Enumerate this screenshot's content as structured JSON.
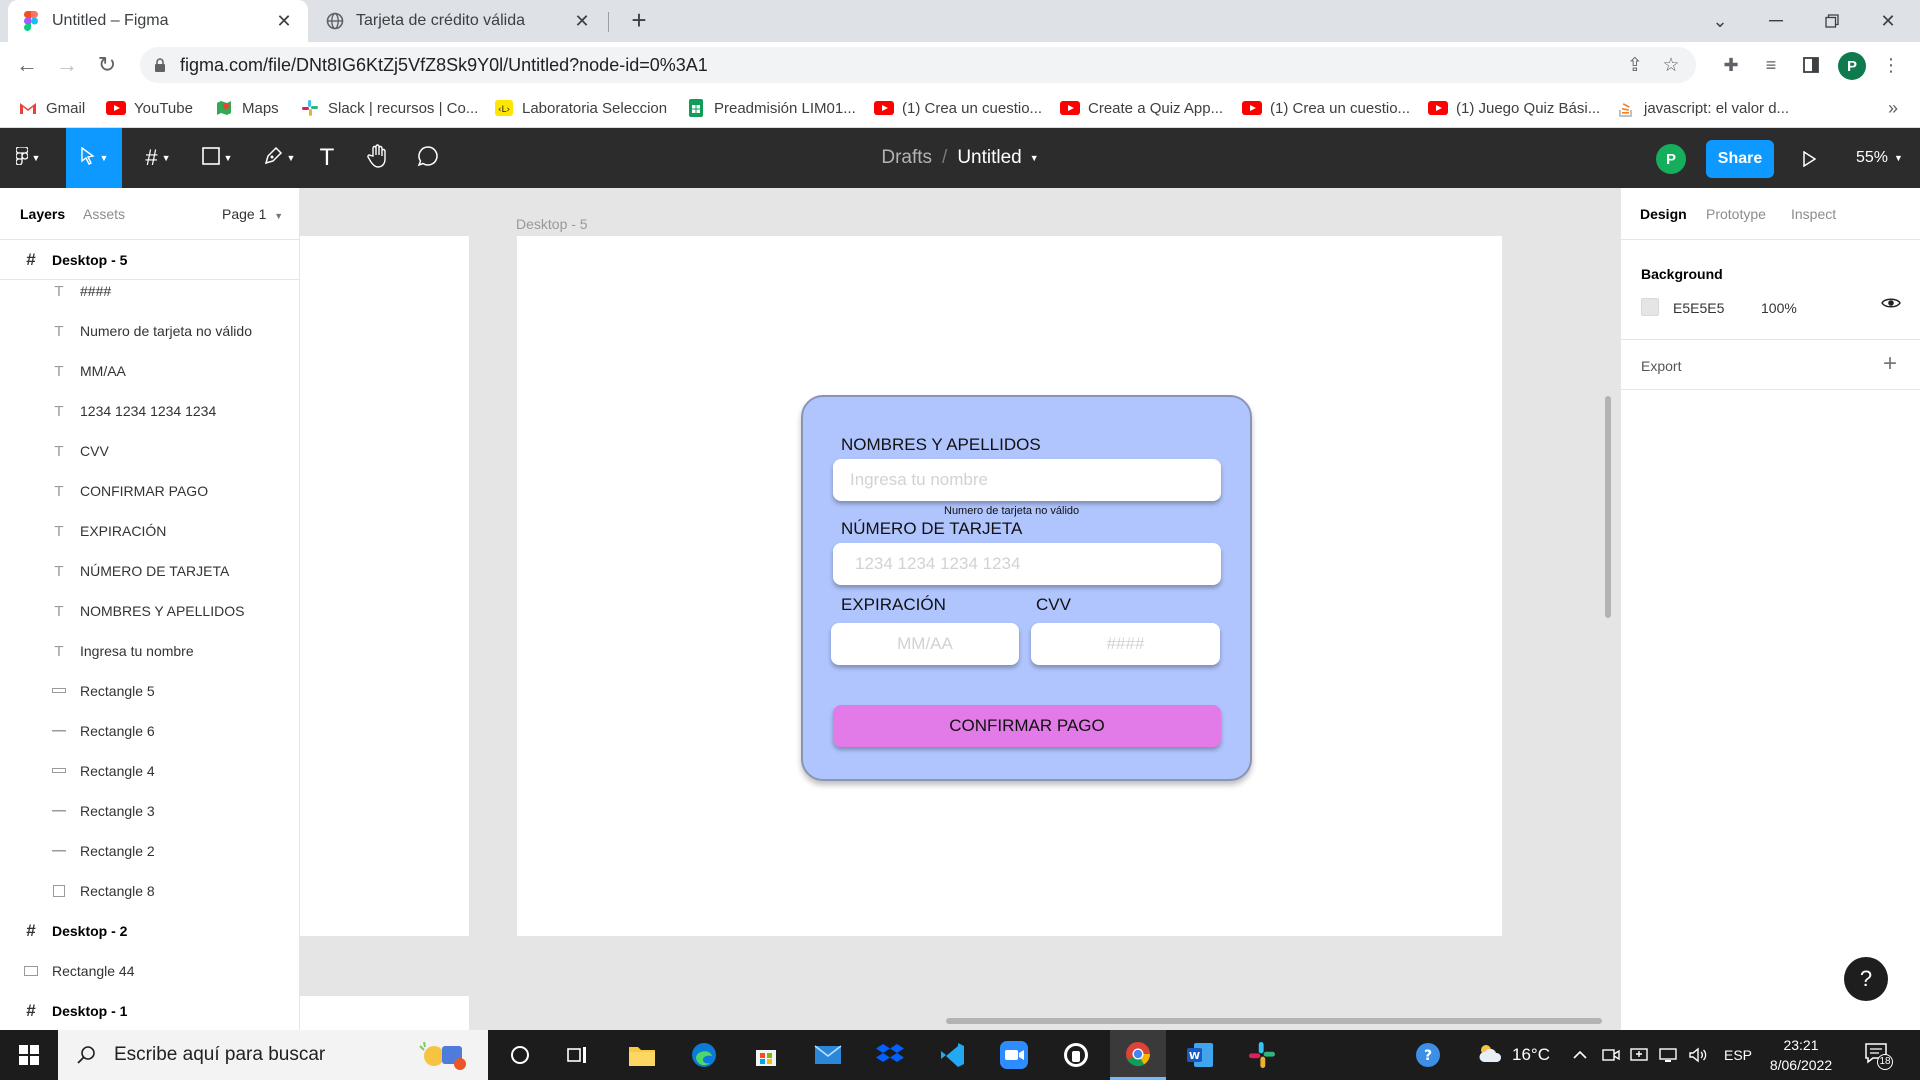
{
  "browser": {
    "tabs": [
      {
        "title": "Untitled – Figma",
        "active": true
      },
      {
        "title": "Tarjeta de crédito válida",
        "active": false
      }
    ],
    "url": "figma.com/file/DNt8IG6KtZj5VfZ8Sk9Y0l/Untitled?node-id=0%3A1",
    "profile_initial": "P",
    "bookmarks": [
      {
        "label": "Gmail",
        "icon": "gmail-icon"
      },
      {
        "label": "YouTube",
        "icon": "youtube-icon"
      },
      {
        "label": "Maps",
        "icon": "maps-icon"
      },
      {
        "label": "Slack | recursos | Co...",
        "icon": "slack-icon"
      },
      {
        "label": "Laboratoria Seleccion",
        "icon": "laboratoria-icon"
      },
      {
        "label": "Preadmisión LIM01...",
        "icon": "sheets-icon"
      },
      {
        "label": "(1) Crea un cuestio...",
        "icon": "youtube-icon"
      },
      {
        "label": "Create a Quiz App...",
        "icon": "youtube-icon"
      },
      {
        "label": "(1) Crea un cuestio...",
        "icon": "youtube-icon"
      },
      {
        "label": "(1) Juego Quiz Bási...",
        "icon": "youtube-icon"
      },
      {
        "label": "javascript: el valor d...",
        "icon": "stackoverflow-icon"
      }
    ],
    "more": "»"
  },
  "figma": {
    "breadcrumb": {
      "drafts": "Drafts",
      "separator": "/",
      "file": "Untitled"
    },
    "avatar_initial": "P",
    "share_label": "Share",
    "zoom": "55%",
    "left_panel": {
      "tabs": [
        "Layers",
        "Assets"
      ],
      "page": "Page 1",
      "layers": [
        {
          "name": "Desktop - 5",
          "type": "frame"
        },
        {
          "name": "####",
          "type": "text"
        },
        {
          "name": "Numero de tarjeta no válido",
          "type": "text"
        },
        {
          "name": "MM/AA",
          "type": "text"
        },
        {
          "name": "1234 1234 1234 1234",
          "type": "text"
        },
        {
          "name": "CVV",
          "type": "text"
        },
        {
          "name": "CONFIRMAR PAGO",
          "type": "text"
        },
        {
          "name": "EXPIRACIÓN",
          "type": "text"
        },
        {
          "name": "NÚMERO DE TARJETA",
          "type": "text"
        },
        {
          "name": "NOMBRES Y APELLIDOS",
          "type": "text"
        },
        {
          "name": "Ingresa tu nombre",
          "type": "text"
        },
        {
          "name": "Rectangle 5",
          "type": "rect-line"
        },
        {
          "name": "Rectangle 6",
          "type": "line"
        },
        {
          "name": "Rectangle 4",
          "type": "rect-line"
        },
        {
          "name": "Rectangle 3",
          "type": "line"
        },
        {
          "name": "Rectangle 2",
          "type": "line"
        },
        {
          "name": "Rectangle 8",
          "type": "rect"
        },
        {
          "name": "Desktop - 2",
          "type": "frame"
        },
        {
          "name": "Rectangle 44",
          "type": "rect-top"
        },
        {
          "name": "Desktop - 1",
          "type": "frame"
        }
      ]
    },
    "canvas": {
      "frame_label": "Desktop - 5",
      "form": {
        "name_label": "NOMBRES Y APELLIDOS",
        "name_placeholder": "Ingresa tu nombre",
        "error_text": "Numero de tarjeta no válido",
        "card_label": "NÚMERO DE TARJETA",
        "card_placeholder": "1234 1234 1234 1234",
        "exp_label": "EXPIRACIÓN",
        "exp_placeholder": "MM/AA",
        "cvv_label": "CVV",
        "cvv_placeholder": "####",
        "confirm_label": "CONFIRMAR PAGO"
      },
      "colors": {
        "card_bg": "#b0c4fd",
        "button_bg": "#e27ae8",
        "frame_bg": "#ffffff",
        "canvas_bg": "#e5e5e5"
      }
    },
    "right_panel": {
      "tabs": [
        "Design",
        "Prototype",
        "Inspect"
      ],
      "background_label": "Background",
      "bg_hex": "E5E5E5",
      "bg_opacity": "100%",
      "export_label": "Export",
      "add_symbol": "+"
    },
    "help_symbol": "?"
  },
  "taskbar": {
    "search_placeholder": "Escribe aquí para buscar",
    "temperature": "16°C",
    "language": "ESP",
    "time": "23:21",
    "date": "8/06/2022",
    "notifications": "18"
  }
}
